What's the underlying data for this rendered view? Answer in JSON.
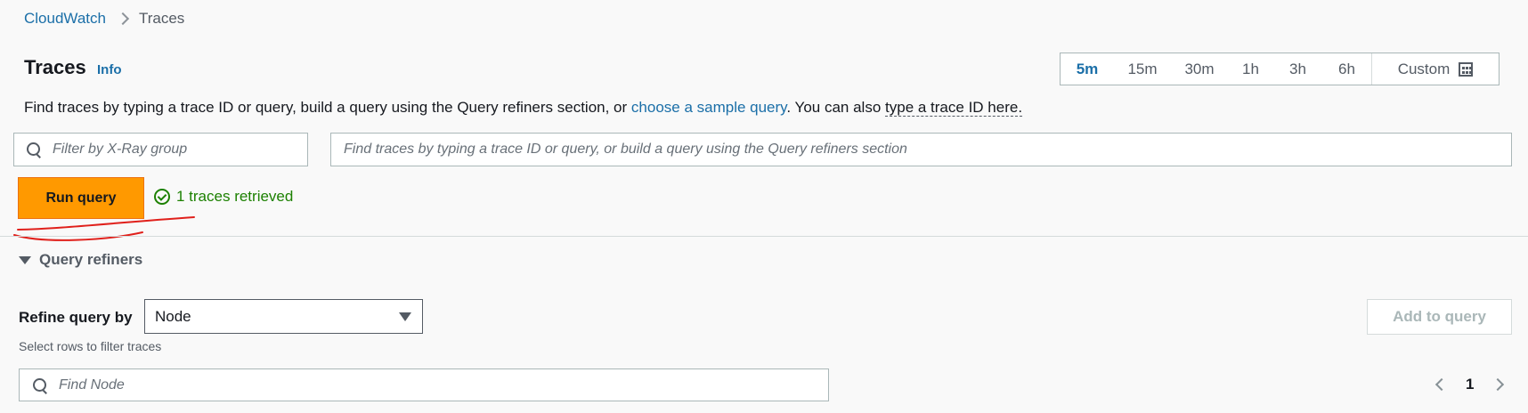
{
  "breadcrumb": {
    "parent": "CloudWatch",
    "current": "Traces"
  },
  "header": {
    "title": "Traces",
    "info": "Info"
  },
  "time_range": {
    "options": [
      "5m",
      "15m",
      "30m",
      "1h",
      "3h",
      "6h"
    ],
    "selected": "5m",
    "custom": "Custom"
  },
  "description": {
    "part1": "Find traces by typing a trace ID or query, build a query using the Query refiners section, or ",
    "link1": "choose a sample query",
    "part2": ". You can also ",
    "link2": "type a trace ID here."
  },
  "xray_filter": {
    "placeholder": "Filter by X-Ray group"
  },
  "query_input": {
    "placeholder": "Find traces by typing a trace ID or query, or build a query using the Query refiners section"
  },
  "run_button": "Run query",
  "status": {
    "text": "1 traces retrieved",
    "color": "#1d8102"
  },
  "refiners": {
    "toggle_label": "Query refiners",
    "refine_label": "Refine query by",
    "selected": "Node",
    "add_button": "Add to query",
    "helper": "Select rows to filter traces",
    "find_placeholder": "Find Node"
  },
  "pagination": {
    "current_page": "1"
  },
  "colors": {
    "accent": "#1b6fa8",
    "primary_button": "#ff9900",
    "annotation": "#e0201b"
  }
}
